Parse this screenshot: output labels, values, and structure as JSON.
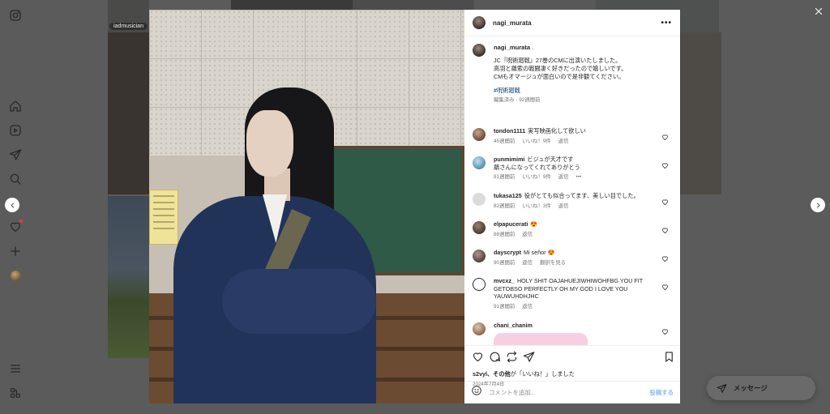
{
  "nav": {
    "icons": [
      "instagram-logo-icon",
      "home-icon",
      "reels-icon",
      "direct-icon",
      "search-icon",
      "notifications-heart-icon",
      "create-plus-icon",
      "profile-avatar",
      "menu-icon",
      "threads-icon"
    ]
  },
  "background": {
    "tile_tag": "iadmusician"
  },
  "post": {
    "username": "nagi_murata",
    "more_label": "•••",
    "caption": {
      "username": "nagi_murata",
      "suffix": " .",
      "lines": [
        "JC『呪術廻戦』27巻のCMに出演いたしました。",
        "高羽と羂索の戦闘凄く好きだったので嬉しいです。",
        "CMもオマージュが面白いので是非観てください。"
      ],
      "hashtag": "#呪術廻戦",
      "meta": "編集済み · 92週間前"
    },
    "comments": [
      {
        "username": "tondon1111",
        "text": "実写映画化して欲しい",
        "lines": [],
        "time": "45週間前",
        "likes": "いいね！9件",
        "reply": "返信",
        "extra": ""
      },
      {
        "username": "punmimimi",
        "text": "ビジュが天才です",
        "lines": [
          "羂さんになってくれてありがとう"
        ],
        "time": "81週間前",
        "likes": "いいね！9件",
        "reply": "返信",
        "extra": "•••"
      },
      {
        "username": "tukasa125",
        "text": "役がとても似合ってます、美しい目でした。",
        "lines": [],
        "time": "82週間前",
        "likes": "いいね！3件",
        "reply": "返信",
        "extra": ""
      },
      {
        "username": "elpapucerati",
        "text": "😍",
        "lines": [],
        "time": "88週間前",
        "likes": "",
        "reply": "返信",
        "extra": ""
      },
      {
        "username": "dayscrypt",
        "text": "Mi señor 😍",
        "lines": [],
        "time": "90週間前",
        "likes": "",
        "reply": "返信",
        "extra": "翻訳を見る"
      },
      {
        "username": "mvcxz_",
        "text": "HOLY SHIT OAJAHUEJIWHIWOHFBG YOU FIT",
        "lines": [
          "GETOBSO PERFECTLY OH MY GOD I LOVE YOU",
          "YAUWUHDHJHC"
        ],
        "time": "91週間前",
        "likes": "",
        "reply": "返信",
        "extra": ""
      },
      {
        "username": "chani_chanim",
        "text": "",
        "lines": [],
        "time": "",
        "likes": "",
        "reply": "",
        "extra": ""
      }
    ],
    "likes_text": {
      "names": "s2vyl、その他",
      "rest": "が「いいね！」しました"
    },
    "date": "2024年7月4日",
    "comment_placeholder": "コメントを追加...",
    "post_label": "投稿する"
  },
  "messages_label": "メッセージ",
  "colors": {
    "overlay": "#5b5b5b",
    "link": "#00376b",
    "post_button": "#8fb9f2",
    "notification_dot": "#ff3040"
  }
}
